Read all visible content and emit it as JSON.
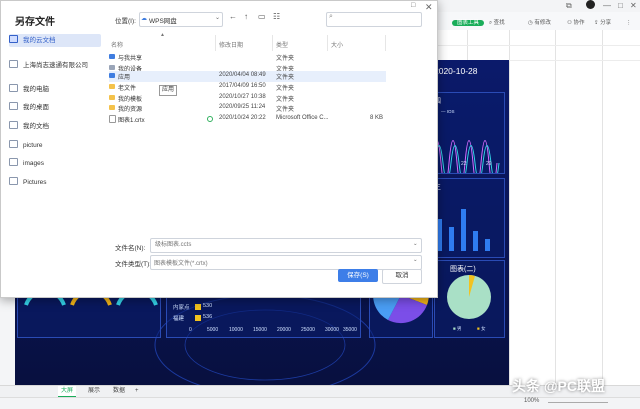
{
  "app": {
    "toolbar": {
      "chart_tool": "图表工具",
      "clock": "有修改",
      "collab": "协作",
      "share": "分享",
      "find": "查找"
    },
    "window_buttons": [
      "□",
      "—",
      "□",
      "✕"
    ],
    "dashboard": {
      "date": "2020-10-28",
      "line_panel_title": "四",
      "line_legend": "IOS",
      "line_ticks": [
        "5",
        "22",
        "29"
      ],
      "bar_panel_title": "三",
      "pie2_title": "图表(二)",
      "pie2_legend": [
        "男",
        "女"
      ],
      "hbar_labels": [
        "内家点",
        "福建"
      ],
      "hbar_values": [
        "530",
        "536"
      ],
      "hbar_axis": [
        "0",
        "5000",
        "10000",
        "15000",
        "20000",
        "25000",
        "30000",
        "35000"
      ]
    },
    "sheet_tabs": [
      "大屏",
      "展示",
      "数据"
    ],
    "add_tab": "+",
    "zoom": "100%",
    "watermark": "头条 @PC联盟"
  },
  "dialog": {
    "title": "另存文件",
    "sidebar": [
      {
        "label": "我的云文档",
        "selected": true
      },
      {
        "label": "上海尚志速通有限公司"
      },
      {
        "label": "我的电脑"
      },
      {
        "label": "我的桌面"
      },
      {
        "label": "我的文档"
      },
      {
        "label": "picture"
      },
      {
        "label": "images"
      },
      {
        "label": "Pictures"
      }
    ],
    "location_label": "位置(I):",
    "location_value": "WPS网盘",
    "columns": [
      "名称",
      "修改日期",
      "类型",
      "大小"
    ],
    "files": [
      {
        "name": "与我共享",
        "date": "",
        "type": "文件夹",
        "size": "",
        "icon": "share"
      },
      {
        "name": "我的设备",
        "date": "",
        "type": "文件夹",
        "size": "",
        "icon": "device"
      },
      {
        "name": "应用",
        "date": "2020/04/04 08:49",
        "type": "文件夹",
        "size": "",
        "icon": "folder"
      },
      {
        "name": "老文件",
        "date": "2017/04/09 16:50",
        "type": "文件夹",
        "size": "",
        "icon": "folder"
      },
      {
        "name": "我的模板",
        "date": "2020/10/27 10:38",
        "type": "文件夹",
        "size": "",
        "icon": "folder"
      },
      {
        "name": "我的资源",
        "date": "2020/09/25 11:24",
        "type": "文件夹",
        "size": "",
        "icon": "folder"
      },
      {
        "name": "图表1.crtx",
        "date": "2020/10/24 20:22",
        "type": "Microsoft Office C...",
        "size": "8 KB",
        "icon": "doc"
      }
    ],
    "tooltip": "应用",
    "filename_label": "文件名(N):",
    "filename_placeholder": "级标图表.ccts",
    "filetype_label": "文件类型(T):",
    "filetype_value": "图表模板文件(*.crtx)",
    "save_label": "保存(S)",
    "cancel_label": "取消"
  },
  "colors": {
    "accent": "#3d7ee8",
    "selection": "#dde6f8",
    "dashboard_bg": "#0b1a6b",
    "chart_tool": "#1aad5a"
  }
}
